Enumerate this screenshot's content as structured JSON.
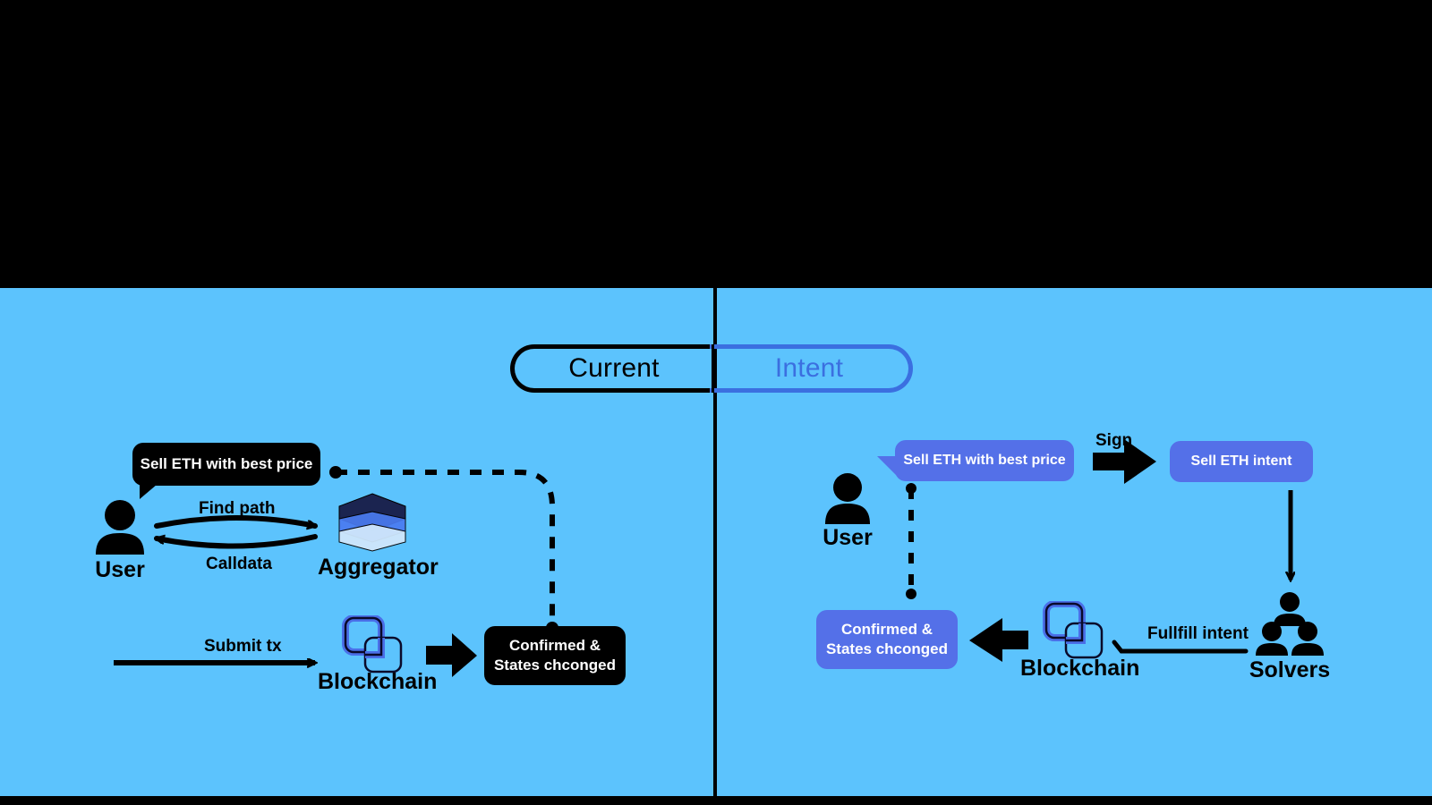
{
  "diagram": {
    "title": "Current vs Intent transaction flow",
    "background_color": "#5CC3FD",
    "band_color": "#000000",
    "accent_blue": "#5470E8",
    "toggle_blue": "#3B6FE0"
  },
  "toggle": {
    "left_label": "Current",
    "right_label": "Intent"
  },
  "left_panel": {
    "name": "Current",
    "user": {
      "label": "User",
      "icon": "person-icon"
    },
    "speech_bubble": "Sell ETH with best price",
    "aggregator": {
      "label": "Aggregator",
      "icon": "layers-stack-icon"
    },
    "blockchain": {
      "label": "Blockchain",
      "icon": "blockchain-blocks-icon"
    },
    "arrows": {
      "find_path": "Find path",
      "calldata": "Calldata",
      "submit_tx": "Submit tx"
    },
    "result": {
      "line1": "Confirmed &",
      "line2": "States chconged"
    }
  },
  "right_panel": {
    "name": "Intent",
    "user": {
      "label": "User",
      "icon": "person-icon"
    },
    "speech_bubble": "Sell ETH with best price",
    "sign_label": "Sign",
    "intent_chip": "Sell ETH intent",
    "solvers": {
      "label": "Solvers",
      "icon": "three-people-icon"
    },
    "blockchain": {
      "label": "Blockchain",
      "icon": "blockchain-blocks-icon"
    },
    "arrows": {
      "fulfill_intent": "Fullfill intent"
    },
    "result": {
      "line1": "Confirmed &",
      "line2": "States chconged"
    }
  }
}
